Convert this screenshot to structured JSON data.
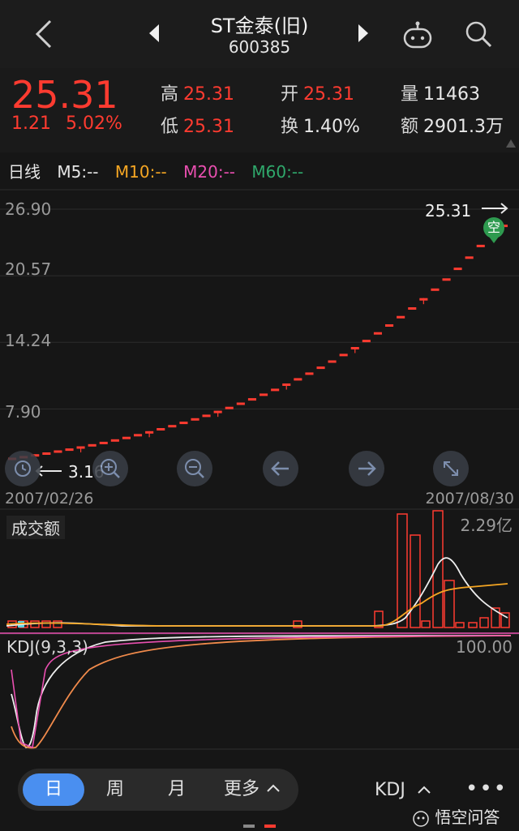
{
  "header": {
    "title": "ST金泰(旧)",
    "code": "600385"
  },
  "quote": {
    "price": "25.31",
    "change": "1.21",
    "change_pct": "5.02%",
    "high_label": "高",
    "high": "25.31",
    "open_label": "开",
    "open": "25.31",
    "volume_label": "量",
    "volume": "11463",
    "low_label": "低",
    "low": "25.31",
    "turnover_label": "换",
    "turnover": "1.40%",
    "amount_label": "额",
    "amount": "2901.3万"
  },
  "ma_legend": {
    "period": "日线",
    "m5": "M5:--",
    "m10": "M10:--",
    "m20": "M20:--",
    "m60": "M60:--",
    "colors": {
      "m5": "#e6e6e6",
      "m10": "#f5a623",
      "m20": "#e94fb0",
      "m60": "#2fa86b"
    }
  },
  "chart": {
    "y_ticks": [
      "26.90",
      "20.57",
      "14.24",
      "7.90"
    ],
    "last_label": "25.31",
    "first_label": "3.16",
    "start_date": "2007/02/26",
    "end_date": "2007/08/30",
    "badge": "空",
    "colors": {
      "up": "#ff3b30",
      "badge": "#2e9a4f"
    }
  },
  "volume": {
    "title": "成交额",
    "max_label": "2.29亿"
  },
  "kdj": {
    "title": "KDJ(9,3,3)",
    "max_label": "100.00"
  },
  "bottom": {
    "tabs": [
      "日",
      "周",
      "月",
      "更多"
    ],
    "indicator": "KDJ",
    "more": "•••",
    "watermark": "悟空问答"
  },
  "chart_data": {
    "type": "line",
    "title": "",
    "series": [
      {
        "name": "",
        "values": [
          3.16,
          3.32,
          3.49,
          3.66,
          3.85,
          4.04,
          4.24,
          4.45,
          4.67,
          4.91,
          5.15,
          5.41,
          5.68,
          5.97,
          6.27,
          6.58,
          6.91,
          7.25,
          7.62,
          8.0,
          8.4,
          8.82,
          9.26,
          9.72,
          10.21,
          10.72,
          11.26,
          11.82,
          12.41,
          13.03,
          13.68,
          14.37,
          15.09,
          15.84,
          16.63,
          17.46,
          18.33,
          19.25,
          20.21,
          21.23,
          22.29,
          23.4,
          24.57,
          25.31
        ]
      }
    ],
    "x": [
      "2007/02/26",
      "2007/08/30"
    ],
    "ylim": [
      3.16,
      26.9
    ],
    "y_ticks": [
      26.9,
      20.57,
      14.24,
      7.9
    ]
  }
}
